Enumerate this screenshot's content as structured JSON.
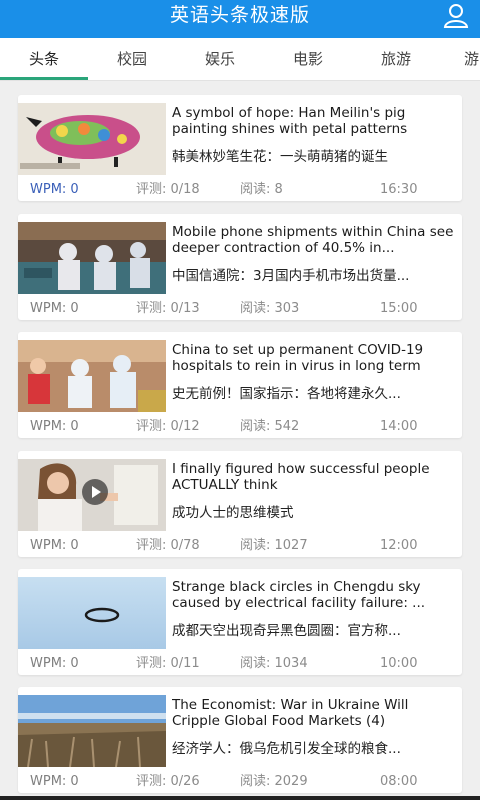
{
  "header": {
    "title": "英语头条极速版",
    "user_icon": "user-icon"
  },
  "tabs": [
    {
      "label": "头条",
      "active": true
    },
    {
      "label": "校园"
    },
    {
      "label": "娱乐"
    },
    {
      "label": "电影"
    },
    {
      "label": "旅游"
    },
    {
      "label": "游"
    }
  ],
  "articles": [
    {
      "title_en": "A symbol of hope: Han Meilin's pig painting shines with petal patterns",
      "title_cn": "韩美林妙笔生花：一头萌萌猪的诞生",
      "wpm": "WPM: 0",
      "test": "评测: 0/18",
      "read": "阅读: 8",
      "time": "16:30",
      "image": "pig-painting-image"
    },
    {
      "title_en": "Mobile phone shipments within China see deeper contraction of 40.5% in...",
      "title_cn": "中国信通院：3月国内手机市场出货量...",
      "wpm": "WPM: 0",
      "test": "评测: 0/13",
      "read": "阅读: 303",
      "time": "15:00",
      "image": "factory-workers-image"
    },
    {
      "title_en": "China to set up permanent COVID-19 hospitals to rein in virus in long term",
      "title_cn": "史无前例！国家指示：各地将建永久...",
      "wpm": "WPM: 0",
      "test": "评测: 0/12",
      "read": "阅读: 542",
      "time": "14:00",
      "image": "medical-workers-image"
    },
    {
      "title_en": "I finally figured how successful people ACTUALLY think",
      "title_cn": "成功人士的思维模式",
      "wpm": "WPM: 0",
      "test": "评测: 0/78",
      "read": "阅读: 1027",
      "time": "12:00",
      "image": "video-woman-image"
    },
    {
      "title_en": "Strange black circles in Chengdu sky caused by electrical facility failure: ...",
      "title_cn": "成都天空出现奇异黑色圆圈：官方称...",
      "wpm": "WPM: 0",
      "test": "评测: 0/11",
      "read": "阅读: 1034",
      "time": "10:00",
      "image": "black-ring-sky-image"
    },
    {
      "title_en": " The Economist: War in Ukraine Will Cripple Global Food Markets (4)",
      "title_cn": "经济学人：俄乌危机引发全球的粮食...",
      "wpm": "WPM: 0",
      "test": "评测: 0/26",
      "read": "阅读: 2029",
      "time": "08:00",
      "image": "dry-field-image"
    }
  ]
}
